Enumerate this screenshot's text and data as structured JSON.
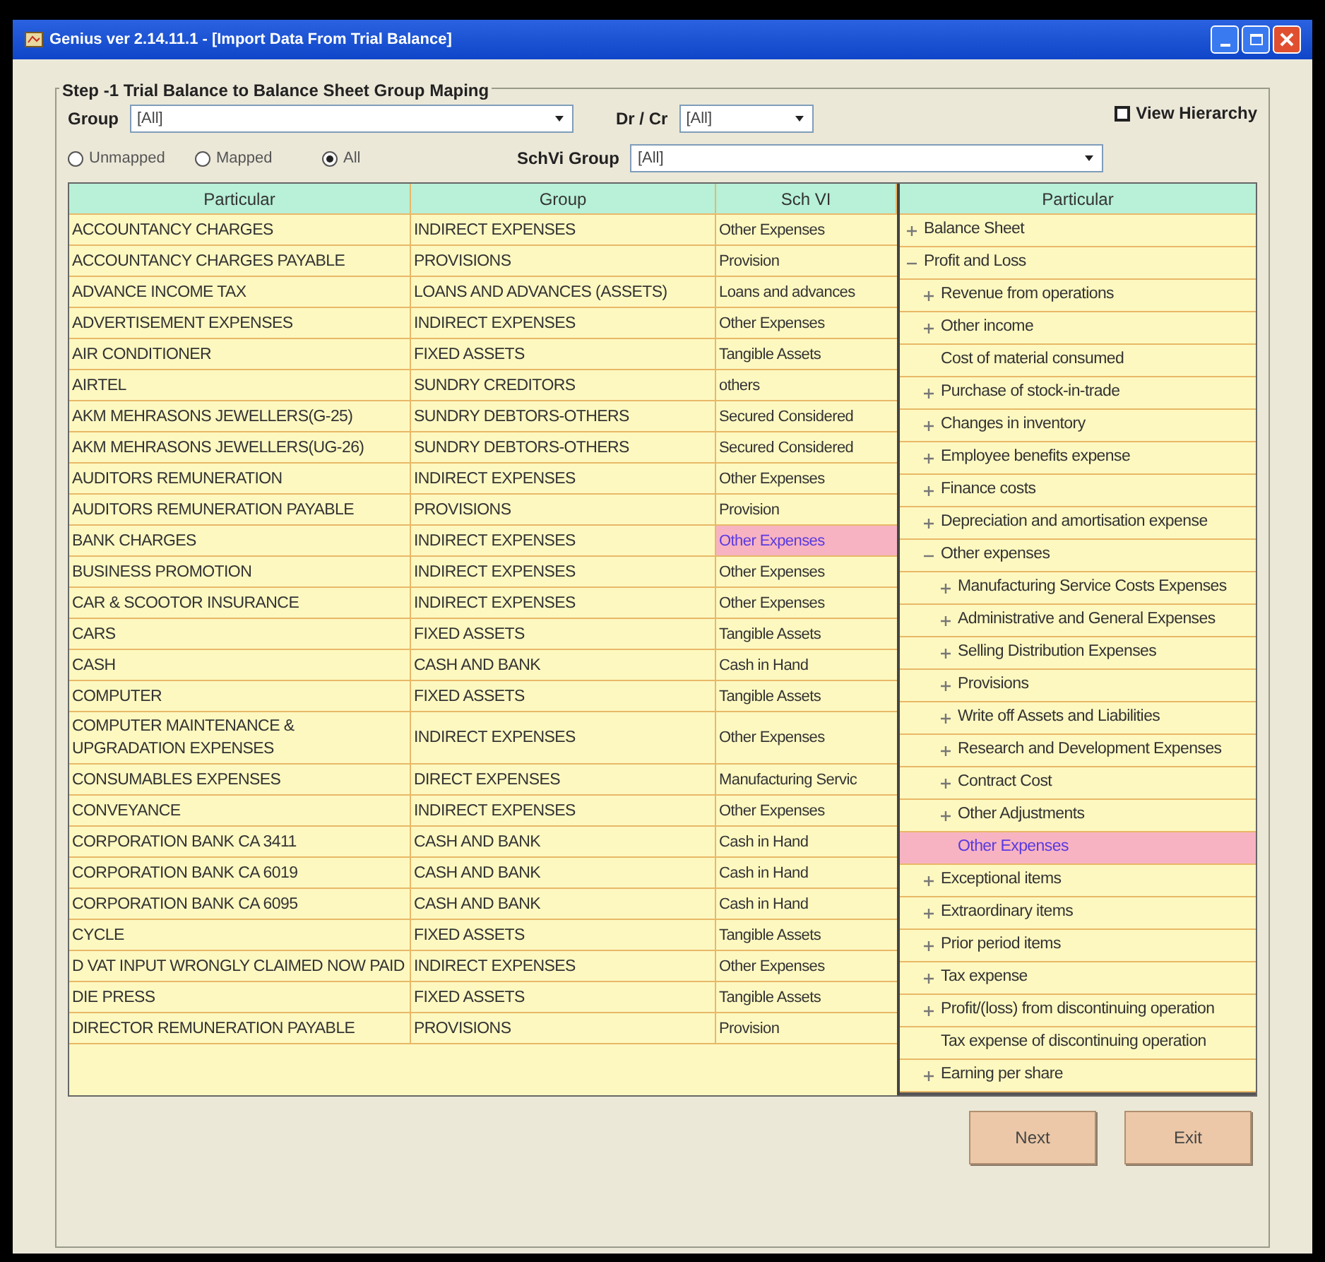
{
  "window": {
    "title": "Genius ver 2.14.11.1 - [Import Data From Trial Balance]"
  },
  "group_box": {
    "title": "Step -1 Trial Balance to Balance Sheet Group Maping"
  },
  "filters": {
    "group": {
      "label": "Group",
      "value": "[All]"
    },
    "dr_cr": {
      "label": "Dr / Cr",
      "value": "[All]"
    },
    "view_hierarchy": {
      "label": "View Hierarchy",
      "checked": false
    },
    "schvi_group": {
      "label": "SchVi Group",
      "value": "[All]"
    }
  },
  "mapping_filter": [
    {
      "label": "Unmapped",
      "selected": false
    },
    {
      "label": "Mapped",
      "selected": false
    },
    {
      "label": "All",
      "selected": true
    }
  ],
  "table": {
    "columns": [
      "Particular",
      "Group",
      "Sch VI"
    ],
    "rows": [
      {
        "particular": "ACCOUNTANCY CHARGES",
        "group": "INDIRECT EXPENSES",
        "sch_vi": "Other Expenses",
        "selected": false
      },
      {
        "particular": "ACCOUNTANCY CHARGES PAYABLE",
        "group": "PROVISIONS",
        "sch_vi": "Provision",
        "selected": false
      },
      {
        "particular": "ADVANCE INCOME TAX",
        "group": "LOANS AND ADVANCES (ASSETS)",
        "sch_vi": "Loans and advances",
        "selected": false
      },
      {
        "particular": "ADVERTISEMENT EXPENSES",
        "group": "INDIRECT EXPENSES",
        "sch_vi": "Other Expenses",
        "selected": false
      },
      {
        "particular": "AIR CONDITIONER",
        "group": "FIXED ASSETS",
        "sch_vi": "Tangible Assets",
        "selected": false
      },
      {
        "particular": "AIRTEL",
        "group": "SUNDRY CREDITORS",
        "sch_vi": "others",
        "selected": false
      },
      {
        "particular": "AKM MEHRASONS JEWELLERS(G-25)",
        "group": "SUNDRY DEBTORS-OTHERS",
        "sch_vi": "Secured Considered",
        "selected": false
      },
      {
        "particular": "AKM MEHRASONS JEWELLERS(UG-26)",
        "group": "SUNDRY DEBTORS-OTHERS",
        "sch_vi": "Secured Considered",
        "selected": false
      },
      {
        "particular": "AUDITORS REMUNERATION",
        "group": "INDIRECT EXPENSES",
        "sch_vi": "Other Expenses",
        "selected": false
      },
      {
        "particular": "AUDITORS REMUNERATION PAYABLE",
        "group": "PROVISIONS",
        "sch_vi": "Provision",
        "selected": false
      },
      {
        "particular": "BANK CHARGES",
        "group": "INDIRECT EXPENSES",
        "sch_vi": "Other Expenses",
        "selected": true
      },
      {
        "particular": "BUSINESS PROMOTION",
        "group": "INDIRECT EXPENSES",
        "sch_vi": "Other Expenses",
        "selected": false
      },
      {
        "particular": "CAR & SCOOTOR INSURANCE",
        "group": "INDIRECT EXPENSES",
        "sch_vi": "Other Expenses",
        "selected": false
      },
      {
        "particular": "CARS",
        "group": "FIXED ASSETS",
        "sch_vi": "Tangible Assets",
        "selected": false
      },
      {
        "particular": "CASH",
        "group": "CASH AND BANK",
        "sch_vi": "Cash in Hand",
        "selected": false
      },
      {
        "particular": "COMPUTER",
        "group": "FIXED ASSETS",
        "sch_vi": "Tangible Assets",
        "selected": false
      },
      {
        "particular": "COMPUTER MAINTENANCE & UPGRADATION EXPENSES",
        "group": "INDIRECT EXPENSES",
        "sch_vi": "Other Expenses",
        "selected": false
      },
      {
        "particular": "CONSUMABLES EXPENSES",
        "group": "DIRECT EXPENSES",
        "sch_vi": "Manufacturing Servic",
        "selected": false
      },
      {
        "particular": "CONVEYANCE",
        "group": "INDIRECT EXPENSES",
        "sch_vi": "Other Expenses",
        "selected": false
      },
      {
        "particular": "CORPORATION BANK CA 3411",
        "group": "CASH AND BANK",
        "sch_vi": "Cash in Hand",
        "selected": false
      },
      {
        "particular": "CORPORATION BANK CA 6019",
        "group": "CASH AND BANK",
        "sch_vi": "Cash in Hand",
        "selected": false
      },
      {
        "particular": "CORPORATION BANK CA 6095",
        "group": "CASH AND BANK",
        "sch_vi": "Cash in Hand",
        "selected": false
      },
      {
        "particular": "CYCLE",
        "group": "FIXED ASSETS",
        "sch_vi": "Tangible Assets",
        "selected": false
      },
      {
        "particular": "D VAT INPUT WRONGLY CLAIMED NOW PAID",
        "group": "INDIRECT EXPENSES",
        "sch_vi": "Other Expenses",
        "selected": false
      },
      {
        "particular": "DIE PRESS",
        "group": "FIXED ASSETS",
        "sch_vi": "Tangible Assets",
        "selected": false
      },
      {
        "particular": "DIRECTOR REMUNERATION PAYABLE",
        "group": "PROVISIONS",
        "sch_vi": "Provision",
        "selected": false
      }
    ]
  },
  "dropdown_tree": {
    "column": "Particular",
    "items": [
      {
        "label": "Balance Sheet",
        "kind": "branch",
        "expanded": false,
        "selected": false
      },
      {
        "label": "Profit and Loss",
        "kind": "branch",
        "expanded": true,
        "selected": false,
        "children": [
          {
            "label": "Revenue from operations",
            "kind": "branch",
            "expanded": false,
            "selected": false
          },
          {
            "label": "Other income",
            "kind": "branch",
            "expanded": false,
            "selected": false
          },
          {
            "label": "Cost of material consumed",
            "kind": "leaf",
            "selected": false
          },
          {
            "label": "Purchase of stock-in-trade",
            "kind": "branch",
            "expanded": false,
            "selected": false
          },
          {
            "label": "Changes in inventory",
            "kind": "branch",
            "expanded": false,
            "selected": false
          },
          {
            "label": "Employee benefits expense",
            "kind": "branch",
            "expanded": false,
            "selected": false
          },
          {
            "label": "Finance costs",
            "kind": "branch",
            "expanded": false,
            "selected": false
          },
          {
            "label": "Depreciation and amortisation expense",
            "kind": "branch",
            "expanded": false,
            "selected": false
          },
          {
            "label": "Other expenses",
            "kind": "branch",
            "expanded": true,
            "selected": false,
            "children": [
              {
                "label": "Manufacturing Service Costs Expenses",
                "kind": "branch",
                "expanded": false,
                "selected": false
              },
              {
                "label": "Administrative and General Expenses",
                "kind": "branch",
                "expanded": false,
                "selected": false
              },
              {
                "label": "Selling Distribution Expenses",
                "kind": "branch",
                "expanded": false,
                "selected": false
              },
              {
                "label": "Provisions",
                "kind": "branch",
                "expanded": false,
                "selected": false
              },
              {
                "label": "Write off Assets and Liabilities",
                "kind": "branch",
                "expanded": false,
                "selected": false
              },
              {
                "label": "Research and Development Expenses",
                "kind": "branch",
                "expanded": false,
                "selected": false
              },
              {
                "label": "Contract Cost",
                "kind": "branch",
                "expanded": false,
                "selected": false
              },
              {
                "label": "Other Adjustments",
                "kind": "branch",
                "expanded": false,
                "selected": false
              },
              {
                "label": "Other Expenses",
                "kind": "leaf",
                "selected": true
              }
            ]
          },
          {
            "label": "Exceptional items",
            "kind": "branch",
            "expanded": false,
            "selected": false
          },
          {
            "label": "Extraordinary items",
            "kind": "branch",
            "expanded": false,
            "selected": false
          },
          {
            "label": "Prior period items",
            "kind": "branch",
            "expanded": false,
            "selected": false
          },
          {
            "label": "Tax expense",
            "kind": "branch",
            "expanded": false,
            "selected": false
          },
          {
            "label": "Profit/(loss) from discontinuing operation",
            "kind": "branch",
            "expanded": false,
            "selected": false
          },
          {
            "label": "Tax expense of discontinuing operation",
            "kind": "leaf",
            "selected": false
          },
          {
            "label": "Earning per share",
            "kind": "branch",
            "expanded": false,
            "selected": false
          }
        ]
      }
    ]
  },
  "buttons": [
    {
      "label": "Next"
    },
    {
      "label": "Exit"
    }
  ]
}
